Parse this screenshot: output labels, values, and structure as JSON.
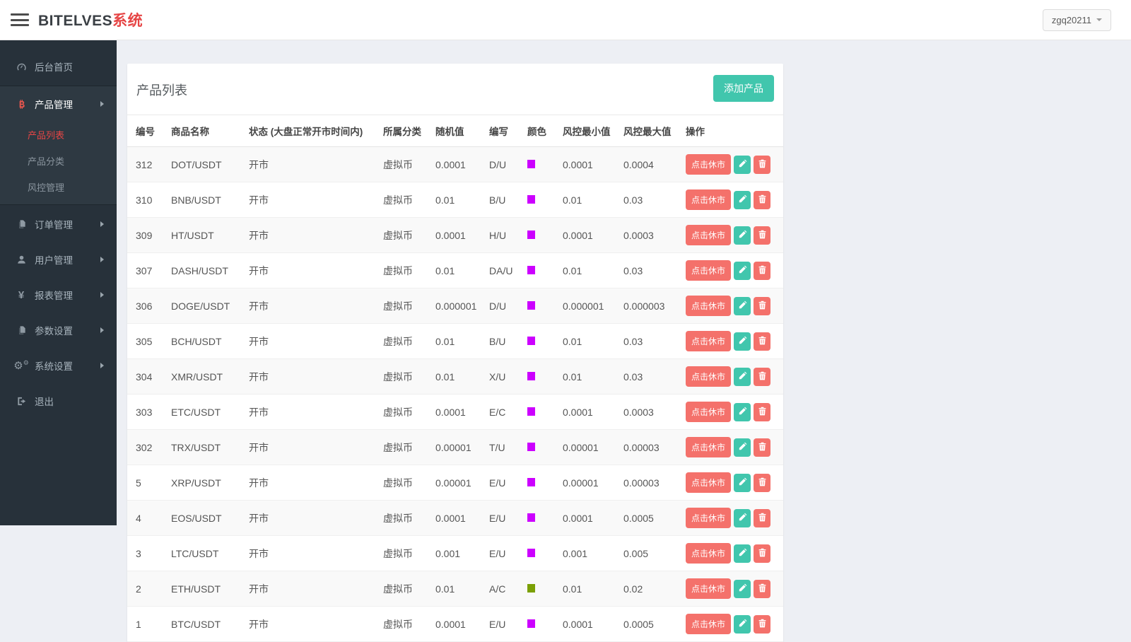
{
  "header": {
    "brand": "BITELVES",
    "brand_suffix": "系统",
    "user": "zgq20211"
  },
  "colors": {
    "brand_red": "#e64545",
    "accent_teal": "#41c6ad",
    "accent_red": "#f4716b",
    "sidebar_bg": "#27313a",
    "page_bg": "#edeff4"
  },
  "sidebar": {
    "items": [
      {
        "label": "后台首页",
        "icon": "dashboard-icon",
        "caret": false
      },
      {
        "label": "产品管理",
        "icon": "bitcoin-icon",
        "caret": true,
        "expanded": true,
        "children": [
          "产品列表",
          "产品分类",
          "风控管理"
        ]
      },
      {
        "label": "订单管理",
        "icon": "files-icon",
        "caret": true
      },
      {
        "label": "用户管理",
        "icon": "user-icon",
        "caret": true
      },
      {
        "label": "报表管理",
        "icon": "yen-icon",
        "caret": true
      },
      {
        "label": "参数设置",
        "icon": "files-icon",
        "caret": true
      },
      {
        "label": "系统设置",
        "icon": "gears-icon",
        "caret": true
      },
      {
        "label": "退出",
        "icon": "logout-icon",
        "caret": false
      }
    ],
    "active_submenu": "产品列表"
  },
  "main": {
    "card_title": "产品列表",
    "add_button": "添加产品",
    "table": {
      "headers": [
        "编号",
        "商品名称",
        "状态 (大盘正常开市时间内)",
        "所属分类",
        "随机值",
        "编写",
        "颜色",
        "风控最小值",
        "风控最大值",
        "操作"
      ],
      "close_market_label": "点击休市",
      "rows": [
        {
          "id": "312",
          "name": "DOT/USDT",
          "status": "开市",
          "category": "虚拟币",
          "random": "0.0001",
          "abbr": "D/U",
          "color": "#cc00ff",
          "min": "0.0001",
          "max": "0.0004"
        },
        {
          "id": "310",
          "name": "BNB/USDT",
          "status": "开市",
          "category": "虚拟币",
          "random": "0.01",
          "abbr": "B/U",
          "color": "#cc00ff",
          "min": "0.01",
          "max": "0.03"
        },
        {
          "id": "309",
          "name": "HT/USDT",
          "status": "开市",
          "category": "虚拟币",
          "random": "0.0001",
          "abbr": "H/U",
          "color": "#cc00ff",
          "min": "0.0001",
          "max": "0.0003"
        },
        {
          "id": "307",
          "name": "DASH/USDT",
          "status": "开市",
          "category": "虚拟币",
          "random": "0.01",
          "abbr": "DA/U",
          "color": "#cc00ff",
          "min": "0.01",
          "max": "0.03"
        },
        {
          "id": "306",
          "name": "DOGE/USDT",
          "status": "开市",
          "category": "虚拟币",
          "random": "0.000001",
          "abbr": "D/U",
          "color": "#cc00ff",
          "min": "0.000001",
          "max": "0.000003"
        },
        {
          "id": "305",
          "name": "BCH/USDT",
          "status": "开市",
          "category": "虚拟币",
          "random": "0.01",
          "abbr": "B/U",
          "color": "#cc00ff",
          "min": "0.01",
          "max": "0.03"
        },
        {
          "id": "304",
          "name": "XMR/USDT",
          "status": "开市",
          "category": "虚拟币",
          "random": "0.01",
          "abbr": "X/U",
          "color": "#cc00ff",
          "min": "0.01",
          "max": "0.03"
        },
        {
          "id": "303",
          "name": "ETC/USDT",
          "status": "开市",
          "category": "虚拟币",
          "random": "0.0001",
          "abbr": "E/C",
          "color": "#cc00ff",
          "min": "0.0001",
          "max": "0.0003"
        },
        {
          "id": "302",
          "name": "TRX/USDT",
          "status": "开市",
          "category": "虚拟币",
          "random": "0.00001",
          "abbr": "T/U",
          "color": "#cc00ff",
          "min": "0.00001",
          "max": "0.00003"
        },
        {
          "id": "5",
          "name": "XRP/USDT",
          "status": "开市",
          "category": "虚拟币",
          "random": "0.00001",
          "abbr": "E/U",
          "color": "#cc00ff",
          "min": "0.00001",
          "max": "0.00003"
        },
        {
          "id": "4",
          "name": "EOS/USDT",
          "status": "开市",
          "category": "虚拟币",
          "random": "0.0001",
          "abbr": "E/U",
          "color": "#cc00ff",
          "min": "0.0001",
          "max": "0.0005"
        },
        {
          "id": "3",
          "name": "LTC/USDT",
          "status": "开市",
          "category": "虚拟币",
          "random": "0.001",
          "abbr": "E/U",
          "color": "#cc00ff",
          "min": "0.001",
          "max": "0.005"
        },
        {
          "id": "2",
          "name": "ETH/USDT",
          "status": "开市",
          "category": "虚拟币",
          "random": "0.01",
          "abbr": "A/C",
          "color": "#7ba005",
          "min": "0.01",
          "max": "0.02"
        },
        {
          "id": "1",
          "name": "BTC/USDT",
          "status": "开市",
          "category": "虚拟币",
          "random": "0.0001",
          "abbr": "E/U",
          "color": "#cc00ff",
          "min": "0.0001",
          "max": "0.0005"
        }
      ]
    }
  }
}
